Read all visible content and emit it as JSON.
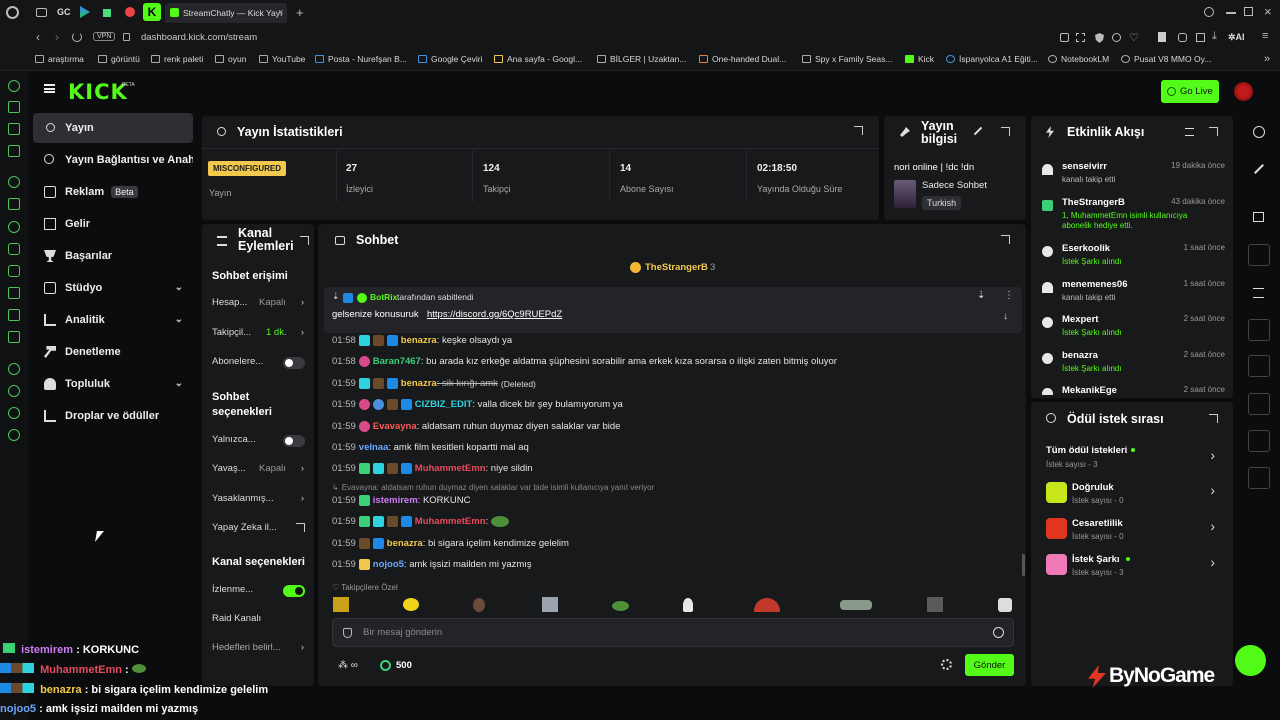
{
  "browser": {
    "tab_title": "StreamChatly — Kick Yayın",
    "tab_short": "GC",
    "url": "dashboard.kick.com/stream",
    "vpn": "VPN",
    "bookmarks": [
      "araştırma",
      "görüntü",
      "renk paleti",
      "oyun",
      "YouTube",
      "Posta - Nurefşan B...",
      "Google Çeviri",
      "Ana sayfa - Googl...",
      "BİLGER | Uzaktan...",
      "One-handed Dual...",
      "Spy x Family Seas...",
      "Kick",
      "İspanyolca A1 Eğiti...",
      "NotebookLM",
      "Pusat V8 MMO Oy..."
    ]
  },
  "header": {
    "logo": "KICK",
    "logo_badge": "BETA",
    "go_live": "Go Live",
    "accent": "#53fc18"
  },
  "sidebar": {
    "items": [
      {
        "label": "Yayın",
        "icon": "broadcast-icon",
        "active": true
      },
      {
        "label": "Yayın Bağlantısı ve Anahtarı",
        "icon": "link-icon"
      },
      {
        "label": "Reklam",
        "icon": "ad-icon",
        "badge": "Beta"
      },
      {
        "label": "Gelir",
        "icon": "revenue-icon"
      },
      {
        "label": "Başarılar",
        "icon": "trophy-icon"
      },
      {
        "label": "Stüdyo",
        "icon": "studio-icon",
        "expandable": true
      },
      {
        "label": "Analitik",
        "icon": "analytics-icon",
        "expandable": true
      },
      {
        "label": "Denetleme",
        "icon": "hammer-icon"
      },
      {
        "label": "Topluluk",
        "icon": "community-icon",
        "expandable": true
      },
      {
        "label": "Droplar ve ödüller",
        "icon": "drops-icon"
      }
    ]
  },
  "stats": {
    "title": "Yayın İstatistikleri",
    "status_badge": "MISCONFIGURED",
    "status_label": "Yayın",
    "items": [
      {
        "value": "27",
        "label": "İzleyici"
      },
      {
        "value": "124",
        "label": "Takipçi"
      },
      {
        "value": "14",
        "label": "Abone Sayısı"
      },
      {
        "value": "02:18:50",
        "label": "Yayında Olduğu Süre"
      }
    ]
  },
  "stream_info": {
    "title": "Yayın bilgisi",
    "stream_title": "nori online | !dc !dn",
    "category": "Sadece Sohbet",
    "language": "Turkish"
  },
  "events": {
    "title": "Etkinlik Akışı",
    "items": [
      {
        "name": "senseivirr",
        "sub": "kanalı takip etti",
        "time": "19 dakika önce"
      },
      {
        "name": "TheStrangerB",
        "sub": "1, MuhammetEmn isimli kullanıcıya abonelik hediye etti.",
        "time": "43 dakika önce"
      },
      {
        "name": "Eserkoolik",
        "sub": "İstek Şarkı alındı",
        "time": "1 saat önce"
      },
      {
        "name": "menemenes06",
        "sub": "kanalı takip etti",
        "time": "1 saat önce"
      },
      {
        "name": "Mexpert",
        "sub": "İstek Şarkı alındı",
        "time": "2 saat önce"
      },
      {
        "name": "benazra",
        "sub": "İstek Şarkı alındı",
        "time": "2 saat önce"
      },
      {
        "name": "MekanikEge",
        "sub": "",
        "time": "2 saat önce"
      }
    ]
  },
  "rewards": {
    "title": "Ödül istek sırası",
    "items": [
      {
        "name": "Tüm ödül istekleri",
        "count": "İstek sayısı - 3"
      },
      {
        "name": "Doğruluk",
        "count": "İstek sayısı - 0"
      },
      {
        "name": "Cesaretlilik",
        "count": "İstek sayısı - 0"
      },
      {
        "name": "İstek Şarkı",
        "count": "İstek sayısı - 3"
      }
    ]
  },
  "channel_actions": {
    "title": "Kanal Eylemleri",
    "sec1": "Sohbet erişimi",
    "r1": "Hesap...",
    "r1v": "Kapalı",
    "r2": "Takipçil...",
    "r2v": "1 dk.",
    "r3": "Abonelere...",
    "sec2": "Sohbet seçenekleri",
    "r4": "Yalnızca...",
    "r5": "Yavaş...",
    "r5v": "Kapalı",
    "r6": "Yasaklanmış...",
    "r7": "Yapay Zeka il...",
    "sec3": "Kanal seçenekleri",
    "r8": "İzlenme...",
    "r9": "Raid Kanalı",
    "r10": "Hedefleri belirl..."
  },
  "chat": {
    "title": "Sohbet",
    "top_gifter": "TheStrangerB",
    "top_gifter_count": "3",
    "pinned_by": "BotRix",
    "pinned_by_suffix": "tarafından sabitlendi",
    "pinned_text": "gelsenize konusuruk",
    "pinned_link": "https://discord.gg/6Qc9RUEPdZ",
    "messages": [
      {
        "time": "01:58",
        "user": "benazra",
        "color": "#f2c94c",
        "text": ": keşke olsaydı ya"
      },
      {
        "time": "01:58",
        "user": "Baran7467",
        "color": "#3ad07a",
        "text": ": bu arada kız erkeğe aldatma şüphesini sorabilir ama erkek kıza sorarsa o ilişki zaten bitmiş oluyor"
      },
      {
        "time": "01:59",
        "user": "benazra",
        "color": "#f2c94c",
        "text": ": sik kırığı amk",
        "deleted": "(Deleted)"
      },
      {
        "time": "01:59",
        "user": "CIZBIZ_EDIT",
        "color": "#2fd3e0",
        "text": ": valla dicek bir şey bulamıyorum ya"
      },
      {
        "time": "01:59",
        "user": "Evavayna",
        "color": "#ff5a5a",
        "text": ": aldatsam ruhun duymaz diyen salaklar var bide"
      },
      {
        "time": "01:59",
        "user": "velnaa",
        "color": "#6aa8ff",
        "text": ": amk film kesitleri kopartti mal aq"
      },
      {
        "time": "01:59",
        "user": "MuhammetEmn",
        "color": "#e84a5f",
        "text": ": niye sildin"
      },
      {
        "time": "01:59",
        "user": "istemirem",
        "color": "#d07cf5",
        "text": ": KORKUNC"
      },
      {
        "time": "01:59",
        "user": "MuhammetEmn",
        "color": "#e84a5f",
        "text": ":"
      },
      {
        "time": "01:59",
        "user": "benazra",
        "color": "#f2c94c",
        "text": ": bi sigara içelim kendimize gelelim"
      },
      {
        "time": "01:59",
        "user": "nojoo5",
        "color": "#6aa8ff",
        "text": ": amk işsizi mailden mi yazmış"
      }
    ],
    "reply_note": "Evavayna: aldatsam ruhun duymaz diyen salaklar var bide isimli kullanıcıya yanıt veriyor",
    "followers_only": "Takipçilere Özel",
    "input_placeholder": "Bir mesaj gönderin",
    "points": "500",
    "send": "Gönder"
  },
  "overlay": {
    "lines": [
      {
        "user": "istemirem",
        "color": "#d07cf5",
        "text": " : KORKUNC"
      },
      {
        "user": "MuhammetEmn",
        "color": "#e84a5f",
        "text": " : "
      },
      {
        "user": "benazra",
        "color": "#f2c94c",
        "text": " : bi sigara içelim kendimize gelelim"
      },
      {
        "user": "nojoo5",
        "color": "#6aa8ff",
        "text": " : amk işsizi mailden mi yazmış"
      }
    ],
    "watermark": "ByNoGame"
  }
}
